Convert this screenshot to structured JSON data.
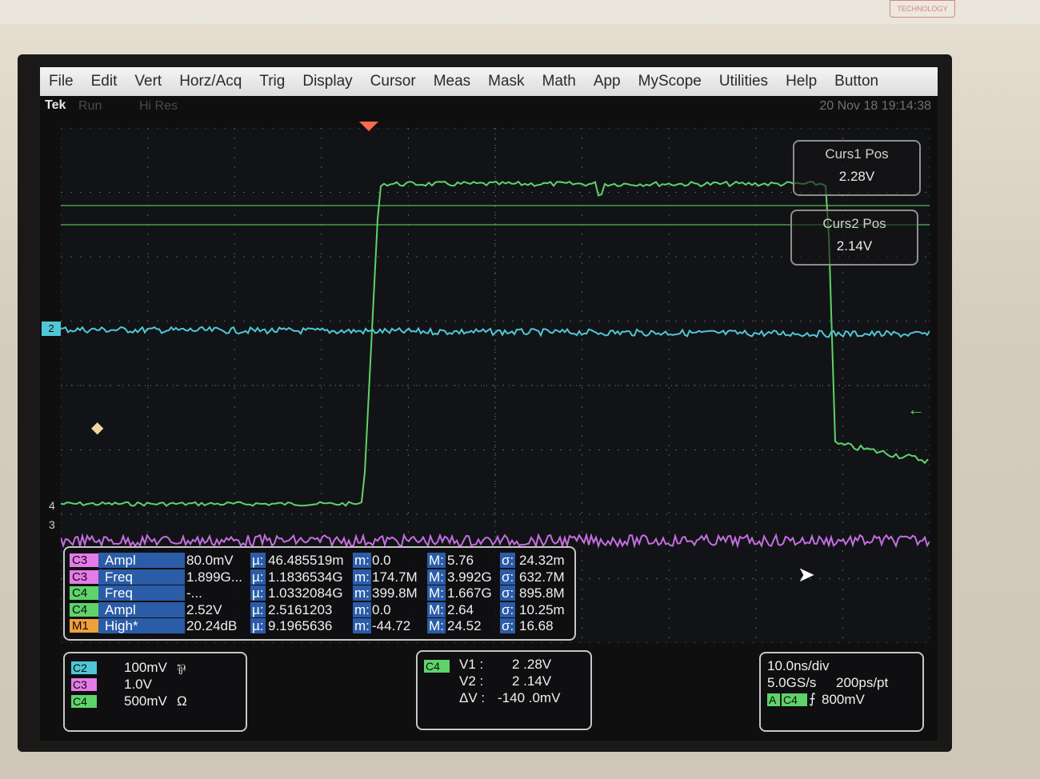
{
  "brand": {
    "logo_text": "TECHNOLOGY"
  },
  "menu": {
    "items": [
      "File",
      "Edit",
      "Vert",
      "Horz/Acq",
      "Trig",
      "Display",
      "Cursor",
      "Meas",
      "Mask",
      "Math",
      "App",
      "MyScope",
      "Utilities",
      "Help",
      "Button"
    ]
  },
  "status": {
    "tek": "Tek",
    "run": "Run",
    "acq_mode": "Hi Res",
    "datetime": "20 Nov 18 19:14:38"
  },
  "cursors": {
    "curs1_title": "Curs1 Pos",
    "curs1_value": "2.28V",
    "curs2_title": "Curs2 Pos",
    "curs2_value": "2.14V"
  },
  "channel_markers": {
    "ch2": "2",
    "ch4": "4",
    "ch3": "3"
  },
  "measurements": {
    "rows": [
      {
        "ch": "C3",
        "name": "Ampl",
        "value": "80.0mV",
        "mu": "46.485519m",
        "m": "0.0",
        "M": "5.76",
        "sigma": "24.32m",
        "color": "#e57be8"
      },
      {
        "ch": "C3",
        "name": "Freq",
        "value": "1.899G...",
        "mu": "1.1836534G",
        "m": "174.7M",
        "M": "3.992G",
        "sigma": "632.7M",
        "color": "#e57be8"
      },
      {
        "ch": "C4",
        "name": "Freq",
        "value": "-...",
        "mu": "1.0332084G",
        "m": "399.8M",
        "M": "1.667G",
        "sigma": "895.8M",
        "color": "#5ed36a"
      },
      {
        "ch": "C4",
        "name": "Ampl",
        "value": "2.52V",
        "mu": "2.5161203",
        "m": "0.0",
        "M": "2.64",
        "sigma": "10.25m",
        "color": "#5ed36a"
      },
      {
        "ch": "M1",
        "name": "High*",
        "value": "20.24dB",
        "mu": "9.1965636",
        "m": "-44.72",
        "M": "24.52",
        "sigma": "16.68",
        "color": "#f0a03a"
      }
    ],
    "labels": {
      "mu": "µ:",
      "m": "m:",
      "M": "M:",
      "sigma": "σ:"
    }
  },
  "vertical": {
    "rows": [
      {
        "ch": "C2",
        "scale": "100mV",
        "extra": "⅌",
        "color": "#4fc7d6"
      },
      {
        "ch": "C3",
        "scale": "1.0V",
        "extra": "",
        "color": "#e57be8"
      },
      {
        "ch": "C4",
        "scale": "500mV",
        "extra": "Ω",
        "color": "#5ed36a"
      }
    ]
  },
  "cursor_readout": {
    "ch": "C4",
    "v1_label": "V1 :",
    "v1": "2 .28V",
    "v2_label": "V2 :",
    "v2": "2 .14V",
    "dv_label": "ΔV :",
    "dv": "-140 .0mV"
  },
  "horizontal": {
    "timebase": "10.0ns/div",
    "sample_rate": "5.0GS/s",
    "resolution": "200ps/pt",
    "trigger_mode": "A",
    "trigger_ch": "C4",
    "trigger_level": "800mV"
  },
  "colors": {
    "ch2": "#4fc7d6",
    "ch3": "#c46ee0",
    "ch4": "#5ed36a"
  }
}
